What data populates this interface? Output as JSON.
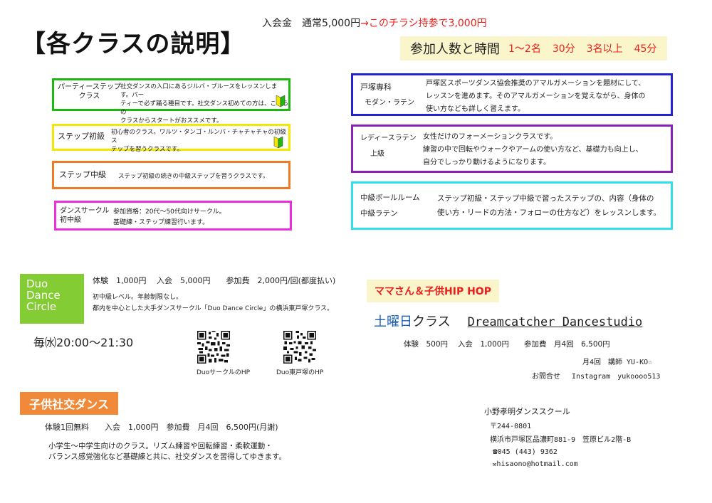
{
  "header": {
    "title": "【各クラスの説明】",
    "fee_prefix": "入会金　通常5,000円",
    "fee_arrow": "→",
    "fee_discount": "このチラシ持参で3,000円"
  },
  "time_box": {
    "label": "参加人数と時間",
    "d1": "1〜2名",
    "d2": "30分",
    "d3": "3名以上",
    "d4": "45分"
  },
  "left_classes": [
    {
      "name1": "パーティーステップ",
      "name2": "クラス",
      "desc": [
        "社交ダンスの入口にあるジルバ・ブルースをレッスンします。パー",
        "ティーで必ず踊る種目です。社交ダンス初めての方は、こちらの",
        "クラスからスタートがおススメです。"
      ],
      "color": "#1fb80f",
      "beginner": true
    },
    {
      "name1": "ステップ初級",
      "name2": "",
      "desc": [
        "初心者のクラス。ワルツ・タンゴ・ルンバ・チャチャチャの初級ス",
        "テップを習うクラスです。"
      ],
      "color": "#f3e800",
      "beginner": true
    },
    {
      "name1": "ステップ中級",
      "name2": "",
      "desc": [
        "ステップ初級の続きの中級ステップを習うクラスです。"
      ],
      "color": "#ef7a26",
      "beginner": false
    },
    {
      "name1": "ダンスサークル",
      "name2": "初中級",
      "desc": [
        "参加資格：20代〜50代向けサークル。",
        "基礎練・ステップ練習行います。"
      ],
      "color": "#ea2fe0",
      "beginner": false
    }
  ],
  "right_classes": [
    {
      "name1": "戸塚専科",
      "name2": "モダン・ラテン",
      "desc": [
        "戸塚区スポーツダンス協会推奨のアマルガメーションを題材にして、",
        "レッスンを進めます。そのアマルガメーションを覚えながら、身体の",
        "使い方なども詳しく習えます。"
      ],
      "color": "#2323d6"
    },
    {
      "name1": "レディースラテン",
      "name2": "上級",
      "desc": [
        "女性だけのフォーメーションクラスです。",
        "練習の中で回転やウォークやアームの使い方など、基礎力も向上し、",
        "自分でしっかり動けるようになります。"
      ],
      "color": "#8a20b8"
    },
    {
      "name1": "中級ボールルーム",
      "name2": "中級ラテン",
      "desc": [
        "ステップ初級・ステップ中級で習ったステップの、内容（身体の",
        "使い方・リードの方法・フォローの仕方など）をレッスンします。"
      ],
      "color": "#2fe0ea"
    }
  ],
  "duo": {
    "logo_lines": [
      "Duo",
      "Dance",
      "Circle"
    ],
    "fees": "体験　1,000円　 入会　5,000円　　参加費　2,000円/回(都度払い)",
    "desc1": "初中級レベル。年齢制限なし。",
    "desc2": "都内を中心とした大手ダンスサークル「Duo Dance Circle」の横浜東戸塚クラス。",
    "schedule": "毎㈬20:00〜21:30",
    "qr1_caption": "DuoサークルのHP",
    "qr2_caption": "Duo東戸塚のHP"
  },
  "kids": {
    "label": "子供社交ダンス",
    "fees": "体験1回無料　　入会　1,000円　参加費　月4回　6,500円(月謝)",
    "desc1": "小学生〜中学生向けのクラス。リズム練習や回転練習・柔軟運動・",
    "desc2": "バランス感覚強化など基礎練と共に、社交ダンスを習得してゆきます。"
  },
  "hiphop": {
    "label": "ママさん＆子供HIP HOP",
    "day": "土曜日",
    "class_word": "クラス",
    "studio": "Dreamcatcher Dancestudio",
    "fees": "体験　500円　 入会　1,000円　　参加費　月4回　6,500円",
    "teacher": "月4回　講師 YU-KO☆",
    "contact": "お問合せ　 Instagram　yukoooo513"
  },
  "school": {
    "name": "小野孝明ダンススクール",
    "zip": "〒244-0801",
    "address": "横浜市戸塚区品濃町881-9　笠原ビル2階-B",
    "tel": "045 (443) 9362",
    "email": "hisaono@hotmail.com"
  },
  "colors": {
    "accent_red": "#e8201c",
    "duo_green": "#84cc33",
    "kids_orange": "#f08a3a",
    "cream": "#fbf5cc",
    "saturday_blue": "#1a5fb4"
  },
  "icons": [
    "beginner-mark-icon",
    "qr-code-icon",
    "phone-icon",
    "mail-icon"
  ]
}
